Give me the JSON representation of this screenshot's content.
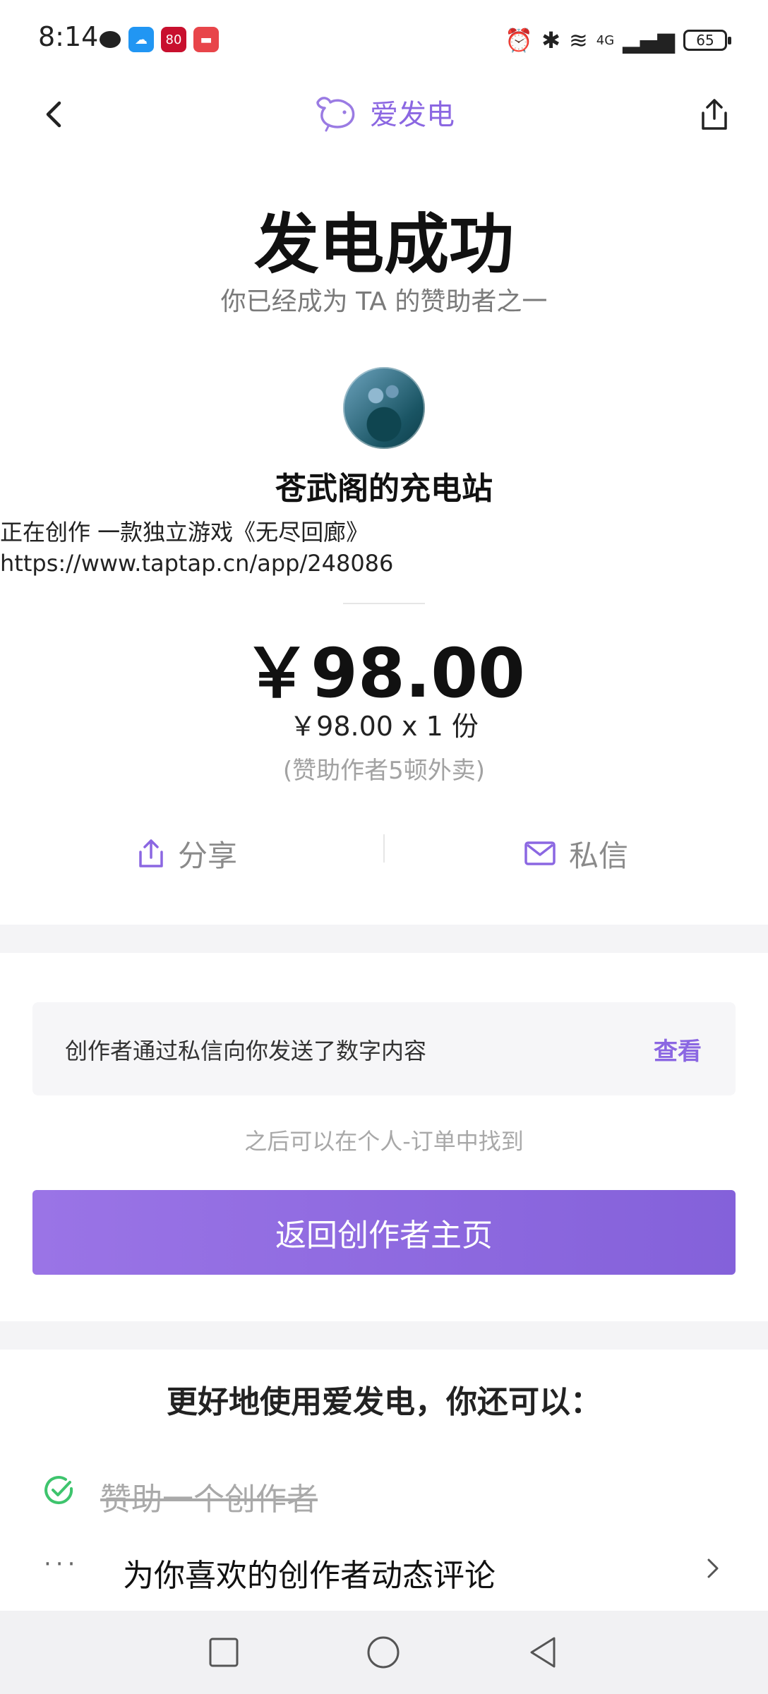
{
  "status_bar": {
    "time": "8:14",
    "app_badge_80": "80",
    "battery": "65",
    "network": "4G"
  },
  "header": {
    "brand": "爱发电",
    "brand_color": "#8b67e2"
  },
  "success": {
    "title": "发电成功",
    "subtitle": "你已经成为 TA 的赞助者之一"
  },
  "creator": {
    "name": "苍武阁的充电站",
    "description": "正在创作 一款独立游戏《无尽回廊》\nhttps://www.taptap.cn/app/248086"
  },
  "payment": {
    "amount": "￥98.00",
    "detail": "￥98.00 x 1 份",
    "note": "(赞助作者5顿外卖)"
  },
  "actions": {
    "share_label": "分享",
    "message_label": "私信"
  },
  "notice": {
    "text": "创作者通过私信向你发送了数字内容",
    "link": "查看",
    "hint": "之后可以在个人-订单中找到",
    "button": "返回创作者主页"
  },
  "tips": {
    "title": "更好地使用爱发电，你还可以：",
    "items": [
      {
        "text": "赞助一个创作者",
        "done": true
      },
      {
        "text": "为你喜欢的创作者动态评论",
        "done": false
      }
    ],
    "done_color": "#3ec46d"
  }
}
